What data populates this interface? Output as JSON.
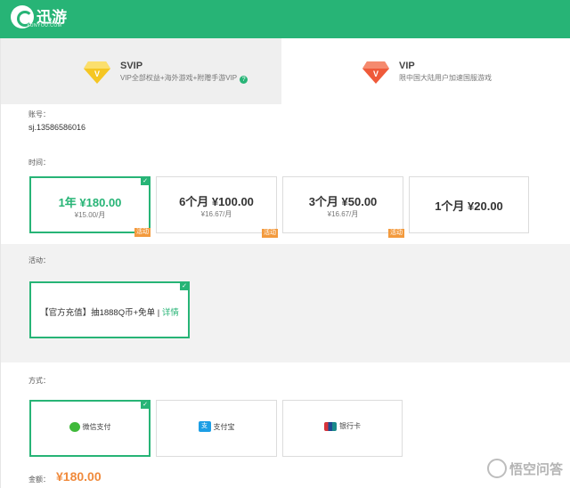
{
  "header": {
    "logo_text": "迅游",
    "logo_subtext": "XUNYOU.COM"
  },
  "plans": [
    {
      "name": "SVIP",
      "desc": "VIP全部权益+海外游戏+附赠手游VIP",
      "help_glyph": "?",
      "selected": true,
      "gem_color": "#f5c623"
    },
    {
      "name": "VIP",
      "desc": "限中国大陆用户加速国服游戏",
      "selected": false,
      "gem_color": "#ef5a3a"
    }
  ],
  "account": {
    "label": "账号：",
    "value": "sj.13586586016"
  },
  "duration": {
    "label": "时间：",
    "options": [
      {
        "title": "1年 ¥180.00",
        "sub": "¥15.00/月",
        "badge": "活动",
        "selected": true
      },
      {
        "title": "6个月 ¥100.00",
        "sub": "¥16.67/月",
        "badge": "活动",
        "selected": false
      },
      {
        "title": "3个月 ¥50.00",
        "sub": "¥16.67/月",
        "badge": "活动",
        "selected": false
      },
      {
        "title": "1个月 ¥20.00",
        "sub": "",
        "badge": "",
        "selected": false
      }
    ]
  },
  "activity": {
    "label": "活动：",
    "text": "【官方充值】抽1888Q币+免单 | ",
    "link": "详情",
    "selected": true
  },
  "payment": {
    "label": "方式：",
    "methods": [
      {
        "label": "微信支付",
        "icon": "wechat-icon",
        "selected": true
      },
      {
        "label": "支付宝",
        "icon": "alipay-icon",
        "icon_glyph": "支",
        "selected": false
      },
      {
        "label": "银行卡",
        "icon": "unionpay-icon",
        "selected": false
      }
    ]
  },
  "total": {
    "label": "金额：",
    "value": "¥180.00"
  },
  "watermark": {
    "text": "悟空问答"
  },
  "colors": {
    "brand_green": "#27b476",
    "accent_orange": "#f08a3c",
    "badge_orange": "#f39a3d"
  },
  "check_glyph": "✓"
}
